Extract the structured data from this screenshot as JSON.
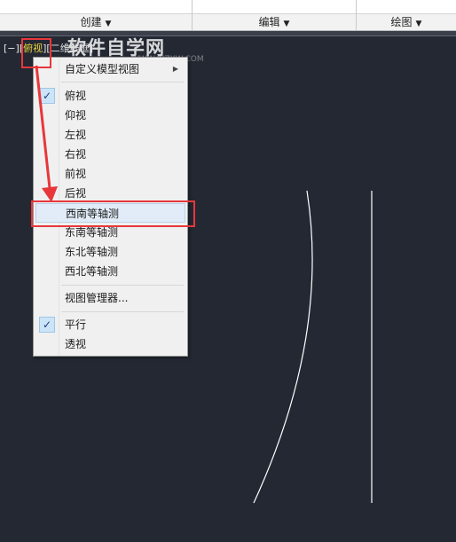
{
  "ribbon": {
    "panels": [
      {
        "label": "创建"
      },
      {
        "label": "编辑"
      },
      {
        "label": "绘图"
      }
    ]
  },
  "viewport_control": {
    "minus": "[−]",
    "view": "俯视",
    "style": "二维线框"
  },
  "watermark": {
    "title": "软件自学网",
    "url": "WWW.RJZXW.COM"
  },
  "menu": {
    "custom_views": "自定义模型视图",
    "views": [
      {
        "label": "俯视",
        "checked": true
      },
      {
        "label": "仰视"
      },
      {
        "label": "左视"
      },
      {
        "label": "右视"
      },
      {
        "label": "前视"
      },
      {
        "label": "后视"
      },
      {
        "label": "西南等轴测",
        "hover": true
      },
      {
        "label": "东南等轴测"
      },
      {
        "label": "东北等轴测"
      },
      {
        "label": "西北等轴测"
      }
    ],
    "view_manager": "视图管理器...",
    "parallel": "平行",
    "perspective": "透视"
  },
  "colors": {
    "canvas_bg": "#232833",
    "highlight_text": "#e9d43c",
    "callout_red": "#e8373b",
    "menu_hover": "#e1ecf8",
    "check_bg": "#cce4f7"
  }
}
